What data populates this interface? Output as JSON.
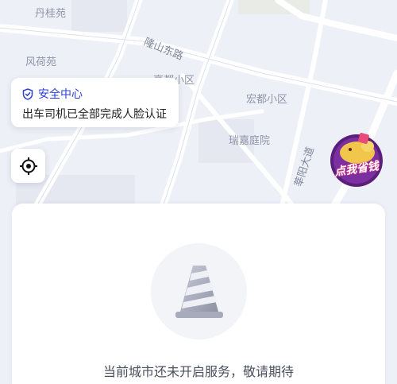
{
  "map": {
    "labels": {
      "danguiyuan": "丹桂苑",
      "fengheyuan": "风荷苑",
      "gaoxing": "高都小区",
      "hongdu": "宏都小区",
      "ruijia": "瑞嘉庭院"
    },
    "roads": {
      "longshan": "隆山东路",
      "xinyang": "莘阳大道"
    }
  },
  "safety_card": {
    "title": "安全中心",
    "subtitle": "出车司机已全部完成人脸认证",
    "accent_color": "#2b3fd6"
  },
  "locate_button": {
    "icon": "locate-crosshair-icon"
  },
  "promo_badge": {
    "text": "点我省钱"
  },
  "panel": {
    "icon": "traffic-cone-icon",
    "message": "当前城市还未开启服务，敬请期待"
  }
}
